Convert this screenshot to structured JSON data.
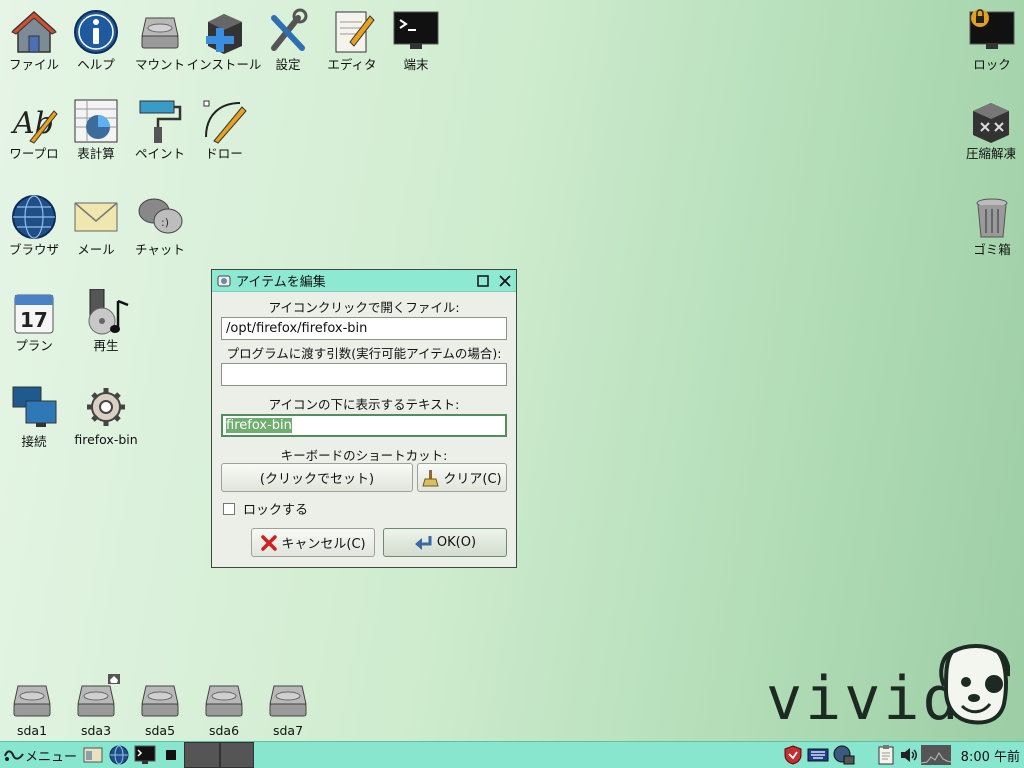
{
  "desktop": {
    "icons_left": [
      {
        "label": "ファイル",
        "icon": "home-icon"
      },
      {
        "label": "ヘルプ",
        "icon": "info-icon"
      },
      {
        "label": "マウント",
        "icon": "drive-icon"
      },
      {
        "label": "インストール",
        "icon": "package-install-icon"
      },
      {
        "label": "設定",
        "icon": "tools-icon"
      },
      {
        "label": "エディタ",
        "icon": "notepad-icon"
      },
      {
        "label": "端末",
        "icon": "terminal-icon"
      },
      {
        "label": "ワープロ",
        "icon": "writer-icon"
      },
      {
        "label": "表計算",
        "icon": "spreadsheet-icon"
      },
      {
        "label": "ペイント",
        "icon": "paint-roller-icon"
      },
      {
        "label": "ドロー",
        "icon": "draw-pen-icon"
      },
      {
        "label": "ブラウザ",
        "icon": "globe-icon"
      },
      {
        "label": "メール",
        "icon": "envelope-icon"
      },
      {
        "label": "チャット",
        "icon": "chat-bubbles-icon"
      },
      {
        "label": "プラン",
        "icon": "calendar-icon"
      },
      {
        "label": "再生",
        "icon": "media-player-icon"
      },
      {
        "label": "接続",
        "icon": "network-icon"
      },
      {
        "label": "firefox-bin",
        "icon": "gear-icon"
      }
    ],
    "icons_right": [
      {
        "label": "ロック",
        "icon": "lock-screen-icon"
      },
      {
        "label": "圧縮解凍",
        "icon": "archive-icon"
      },
      {
        "label": "ゴミ箱",
        "icon": "trash-icon"
      }
    ],
    "drives": [
      {
        "label": "sda1"
      },
      {
        "label": "sda3"
      },
      {
        "label": "sda5"
      },
      {
        "label": "sda6"
      },
      {
        "label": "sda7"
      }
    ],
    "brand": "vivid"
  },
  "dialog": {
    "title": "アイテムを編集",
    "file_label": "アイコンクリックで開くファイル:",
    "file_value": "/opt/firefox/firefox-bin",
    "args_label": "プログラムに渡す引数(実行可能アイテムの場合):",
    "args_value": "",
    "text_label": "アイコンの下に表示するテキスト:",
    "text_value": "firefox-bin",
    "shortcut_label": "キーボードのショートカット:",
    "shortcut_button": "(クリックでセット)",
    "clear_button": "クリア(C)",
    "lock_label": "ロックする",
    "lock_checked": false,
    "cancel_button": "キャンセル(C)",
    "ok_button": "OK(O)"
  },
  "taskbar": {
    "menu_label": "メニュー",
    "clock": "8:00 午前"
  },
  "colors": {
    "taskbar": "#88e6cf",
    "titlebar": "#8ee9d2",
    "selection": "#6fae6f"
  }
}
